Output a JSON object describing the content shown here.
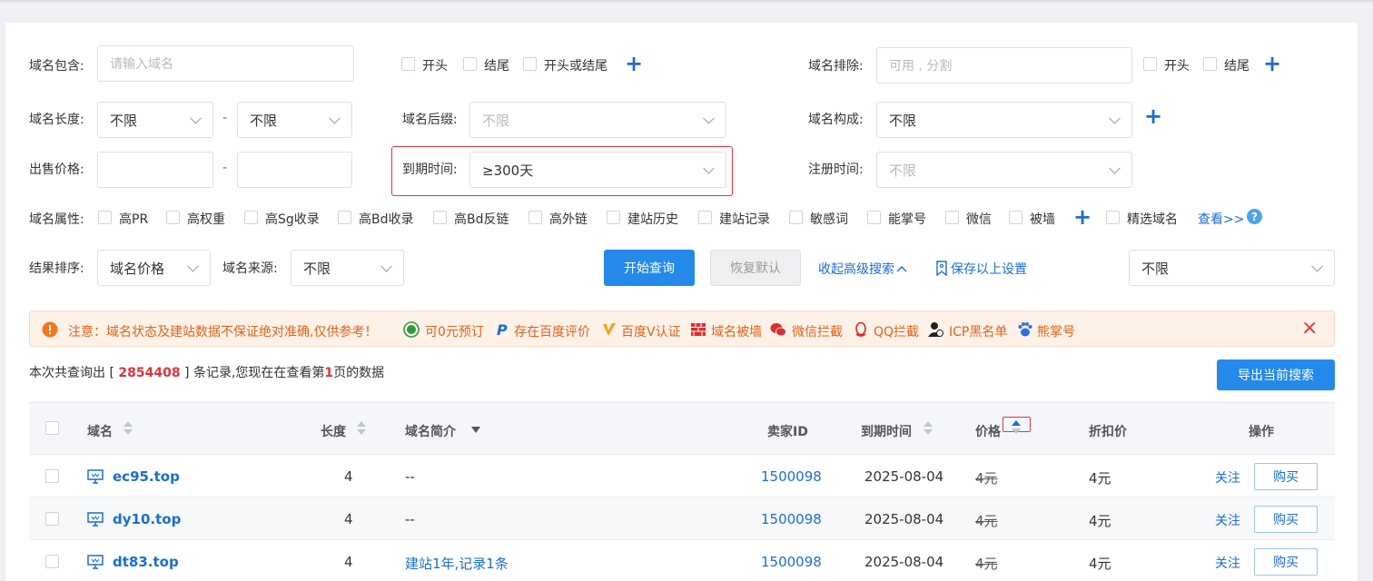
{
  "filters": {
    "domain_contains": {
      "label": "域名包含:",
      "placeholder": "请输入域名",
      "opts": [
        "开头",
        "结尾",
        "开头或结尾"
      ]
    },
    "domain_exclude": {
      "label": "域名排除:",
      "placeholder": "可用 , 分割",
      "opts": [
        "开头",
        "结尾"
      ]
    },
    "domain_length": {
      "label": "域名长度:",
      "from": "不限",
      "sep": "-",
      "to": "不限"
    },
    "domain_suffix": {
      "label": "域名后缀:",
      "value": "不限"
    },
    "domain_composition": {
      "label": "域名构成:",
      "value": "不限"
    },
    "sale_price": {
      "label": "出售价格:",
      "sep": "-"
    },
    "expire_time": {
      "label": "到期时间:",
      "value": "≥300天"
    },
    "register_time": {
      "label": "注册时间:",
      "value": "不限"
    },
    "attributes": {
      "label": "域名属性:",
      "items": [
        "高PR",
        "高权重",
        "高Sg收录",
        "高Bd收录",
        "高Bd反链",
        "高外链",
        "建站历史",
        "建站记录",
        "敏感词",
        "能掌号",
        "微信",
        "被墙"
      ],
      "featured": "精选域名",
      "more": "查看>>",
      "help": "?"
    },
    "sort": {
      "label": "结果排序:",
      "value": "域名价格"
    },
    "source": {
      "label": "域名来源:",
      "value": "不限"
    },
    "right_select": "不限",
    "plus": "+"
  },
  "actions": {
    "search": "开始查询",
    "reset": "恢复默认",
    "collapse": "收起高级搜索",
    "save": "保存以上设置"
  },
  "notice": {
    "main": "注意：域名状态及建站数据不保证绝对准确,仅供参考！",
    "items": [
      "可0元预订",
      "存在百度评价",
      "百度V认证",
      "域名被墙",
      "微信拦截",
      "QQ拦截",
      "ICP黑名单",
      "熊掌号"
    ],
    "close": "×"
  },
  "summary": {
    "prefix": "本次共查询出 [ ",
    "count": "2854408",
    "mid": " ] 条记录,您现在在查看第",
    "page": "1",
    "suffix": "页的数据",
    "export": "导出当前搜索"
  },
  "table": {
    "headers": [
      "域名",
      "长度",
      "域名简介",
      "卖家ID",
      "到期时间",
      "价格",
      "折扣价",
      "操作"
    ],
    "rows": [
      {
        "domain": "ec95.top",
        "length": "4",
        "intro": "--",
        "seller": "1500098",
        "expire": "2025-08-04",
        "price": "4元",
        "discount": "4元",
        "follow": "关注",
        "buy": "购买"
      },
      {
        "domain": "dy10.top",
        "length": "4",
        "intro": "--",
        "seller": "1500098",
        "expire": "2025-08-04",
        "price": "4元",
        "discount": "4元",
        "follow": "关注",
        "buy": "购买"
      },
      {
        "domain": "dt83.top",
        "length": "4",
        "intro": "建站1年,记录1条",
        "seller": "1500098",
        "expire": "2025-08-04",
        "price": "4元",
        "discount": "4元",
        "follow": "关注",
        "buy": "购买"
      }
    ]
  },
  "colors": {
    "accent": "#2589ea",
    "link": "#1a6ed3",
    "highlight": "#e0343a",
    "warning": "#e06419"
  }
}
